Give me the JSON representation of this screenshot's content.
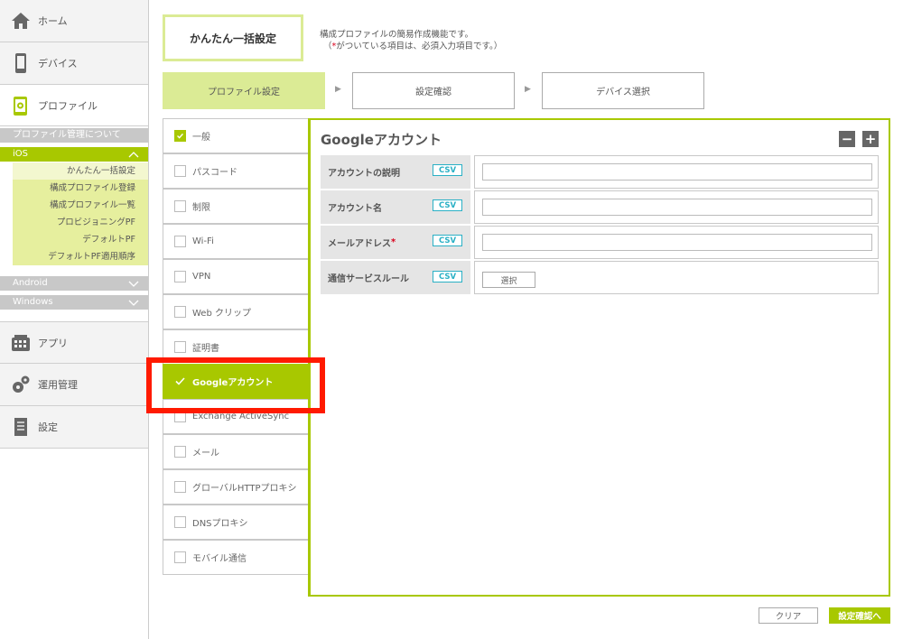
{
  "sidebar": {
    "home": "ホーム",
    "device": "デバイス",
    "profile": "プロファイル",
    "profile_about": "プロファイル管理について",
    "ios": "iOS",
    "ios_items": [
      "かんたん一括設定",
      "構成プロファイル登録",
      "構成プロファイル一覧",
      "プロビジョニングPF",
      "デフォルトPF",
      "デフォルトPF適用順序"
    ],
    "android": "Android",
    "windows": "Windows",
    "app": "アプリ",
    "ops": "運用管理",
    "settings": "設定"
  },
  "header": {
    "title": "かんたん一括設定",
    "desc1": "構成プロファイルの簡易作成機能です。",
    "desc2_pre": "（",
    "desc2_req": "*",
    "desc2_post": "がついている項目は、必須入力項目です。）"
  },
  "steps": [
    "プロファイル設定",
    "設定確認",
    "デバイス選択"
  ],
  "categories": [
    "一般",
    "パスコード",
    "制限",
    "Wi-Fi",
    "VPN",
    "Web クリップ",
    "証明書",
    "Googleアカウント",
    "Exchange ActiveSync",
    "メール",
    "グローバルHTTPプロキシ",
    "DNSプロキシ",
    "モバイル通信"
  ],
  "panel": {
    "title": "Googleアカウント",
    "minus": "−",
    "plus": "+",
    "csv": "CSV",
    "fields": [
      "アカウントの説明",
      "アカウント名",
      "メールアドレス",
      "通信サービスルール"
    ],
    "required_mark": "*",
    "select_button": "選択"
  },
  "footer": {
    "clear": "クリア",
    "confirm": "設定確認へ"
  },
  "colors": {
    "accent": "#a8c800",
    "accent_light": "#dbeb95",
    "highlight": "#ff1a00",
    "csv": "#2ab0c5"
  }
}
